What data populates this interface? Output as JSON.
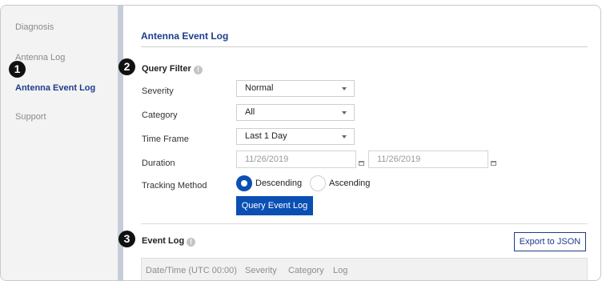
{
  "sidebar": {
    "items": [
      {
        "label": "Diagnosis"
      },
      {
        "label": "Antenna Log"
      },
      {
        "label": "Antenna Event Log"
      },
      {
        "label": "Support"
      }
    ]
  },
  "page": {
    "title": "Antenna Event Log"
  },
  "query_filter": {
    "title": "Query Filter",
    "info": "!",
    "severity": {
      "label": "Severity",
      "value": "Normal"
    },
    "category": {
      "label": "Category",
      "value": "All"
    },
    "time_frame": {
      "label": "Time Frame",
      "value": "Last 1 Day"
    },
    "duration": {
      "label": "Duration",
      "start": "11/26/2019",
      "end": "11/26/2019"
    },
    "tracking_method": {
      "label": "Tracking Method",
      "options": [
        "Descending",
        "Ascending"
      ],
      "selected": "Descending"
    },
    "query_button": "Query Event Log"
  },
  "event_log": {
    "title": "Event Log",
    "info": "!",
    "export_button": "Export to JSON",
    "columns": [
      "Date/Time (UTC 00:00)",
      "Severity",
      "Category",
      "Log"
    ]
  },
  "callouts": [
    "1",
    "2",
    "3"
  ]
}
